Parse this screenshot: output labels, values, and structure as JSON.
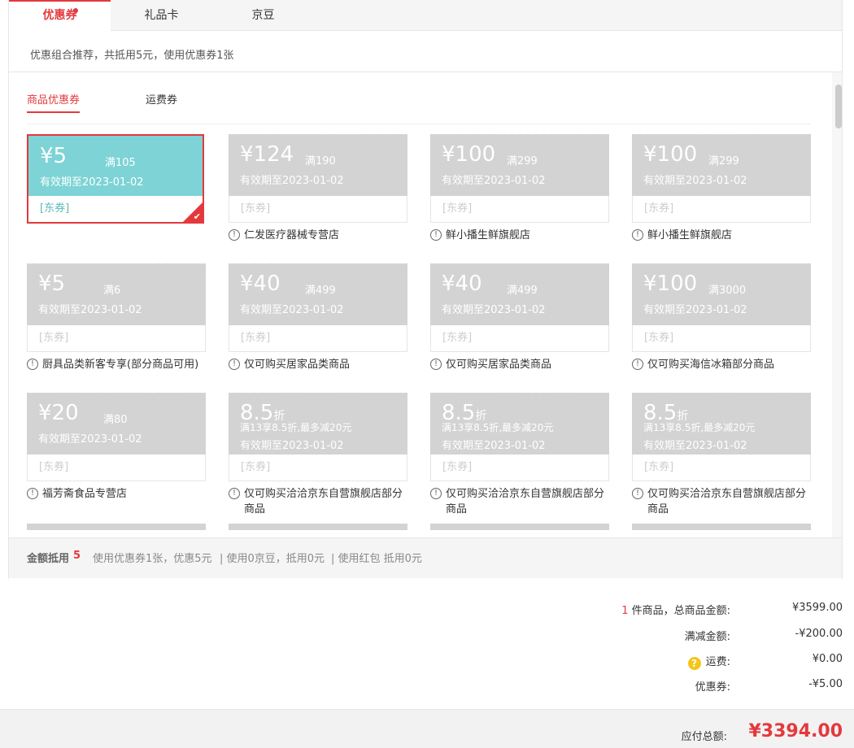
{
  "tabs": [
    {
      "label": "优惠券",
      "active": true,
      "badge": true
    },
    {
      "label": "礼品卡",
      "active": false
    },
    {
      "label": "京豆",
      "active": false
    }
  ],
  "recommend": "优惠组合推荐，共抵用5元，使用优惠券1张",
  "subtabs": [
    {
      "label": "商品优惠券",
      "active": true
    },
    {
      "label": "运费券",
      "active": false
    }
  ],
  "coupons": [
    {
      "type": "amount",
      "amount": "5",
      "condition": "满105",
      "validity": "有效期至2023-01-02",
      "tag": "[东券]",
      "note": "",
      "selected": true
    },
    {
      "type": "amount",
      "amount": "124",
      "condition": "满190",
      "validity": "有效期至2023-01-02",
      "tag": "[东券]",
      "note": "仁发医疗器械专营店"
    },
    {
      "type": "amount",
      "amount": "100",
      "condition": "满299",
      "validity": "有效期至2023-01-02",
      "tag": "[东券]",
      "note": "鲜小播生鲜旗舰店"
    },
    {
      "type": "amount",
      "amount": "100",
      "condition": "满299",
      "validity": "有效期至2023-01-02",
      "tag": "[东券]",
      "note": "鲜小播生鲜旗舰店"
    },
    {
      "type": "amount",
      "amount": "5",
      "condition": "满6",
      "validity": "有效期至2023-01-02",
      "tag": "[东券]",
      "note": "厨具品类新客专享(部分商品可用)"
    },
    {
      "type": "amount",
      "amount": "40",
      "condition": "满499",
      "validity": "有效期至2023-01-02",
      "tag": "[东券]",
      "note": "仅可购买居家品类商品"
    },
    {
      "type": "amount",
      "amount": "40",
      "condition": "满499",
      "validity": "有效期至2023-01-02",
      "tag": "[东券]",
      "note": "仅可购买居家品类商品"
    },
    {
      "type": "amount",
      "amount": "100",
      "condition": "满3000",
      "validity": "有效期至2023-01-02",
      "tag": "[东券]",
      "note": "仅可购买海信冰箱部分商品"
    },
    {
      "type": "amount",
      "amount": "20",
      "condition": "满80",
      "validity": "有效期至2023-01-02",
      "tag": "[东券]",
      "note": "福芳斋食品专营店"
    },
    {
      "type": "discount",
      "amount": "8.5",
      "unit": "折",
      "condition": "满13享8.5折,最多减20元",
      "validity": "有效期至2023-01-02",
      "tag": "[东券]",
      "note": "仅可购买洽洽京东自营旗舰店部分商品"
    },
    {
      "type": "discount",
      "amount": "8.5",
      "unit": "折",
      "condition": "满13享8.5折,最多减20元",
      "validity": "有效期至2023-01-02",
      "tag": "[东券]",
      "note": "仅可购买洽洽京东自营旗舰店部分商品"
    },
    {
      "type": "discount",
      "amount": "8.5",
      "unit": "折",
      "condition": "满13享8.5折,最多减20元",
      "validity": "有效期至2023-01-02",
      "tag": "[东券]",
      "note": "仅可购买洽洽京东自营旗舰店部分商品"
    }
  ],
  "currency_symbol": "¥",
  "info_glyph": "!",
  "summary": {
    "label": "金额抵用",
    "value": "5",
    "coupon_text": "使用优惠券1张，优惠5元",
    "bean_text": "| 使用0京豆，抵用0元",
    "redpack_text": "| 使用红包 抵用0元"
  },
  "totals": {
    "count": "1",
    "items_label": "件商品，总商品金额:",
    "items_value": "¥3599.00",
    "discount_label": "满减金额:",
    "discount_value": "-¥200.00",
    "shipping_label": "运费:",
    "shipping_value": "¥0.00",
    "coupon_label": "优惠券:",
    "coupon_value": "-¥5.00"
  },
  "footer": {
    "label": "应付总额:",
    "value": "¥3394.00"
  },
  "colors": {
    "accent": "#e4393c",
    "selected_coupon": "#7dd3d5",
    "disabled_coupon": "#d3d3d3"
  }
}
